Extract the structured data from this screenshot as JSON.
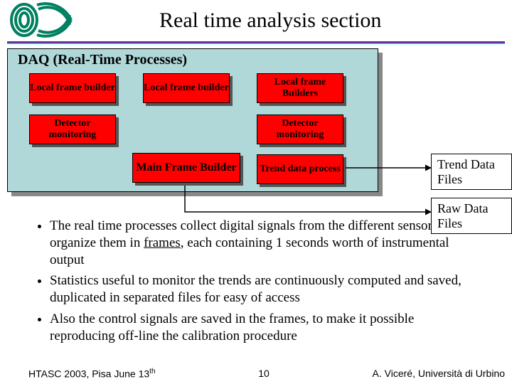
{
  "header": {
    "title": "Real time analysis section"
  },
  "daq": {
    "panel_title": "DAQ  (Real-Time Processes)",
    "boxes": {
      "lfb1": "Local frame builder",
      "lfb2": "Local frame builder",
      "lfbs": "Local frame Builders",
      "det1": "Detector monitoring",
      "det2": "Detector monitoring",
      "mfb": "Main Frame Builder",
      "tdp": "Trend data process"
    }
  },
  "side": {
    "trend": "Trend Data Files",
    "raw": "Raw Data Files"
  },
  "bullets": {
    "b1_pre": "The real time processes collect digital signals from the different sensors and organize them in ",
    "b1_em": "frames",
    "b1_post": ", each containing 1 seconds worth of instrumental output",
    "b2": "Statistics useful to monitor the trends are continuously computed and saved, duplicated in separated files for easy of access",
    "b3": "Also the control signals are saved in the frames, to make it possible reproducing off-line the calibration procedure"
  },
  "footer": {
    "left_pre": "HTASC 2003, Pisa June 13",
    "left_sup": "th",
    "page": "10",
    "right": "A. Viceré, Università di Urbino"
  }
}
